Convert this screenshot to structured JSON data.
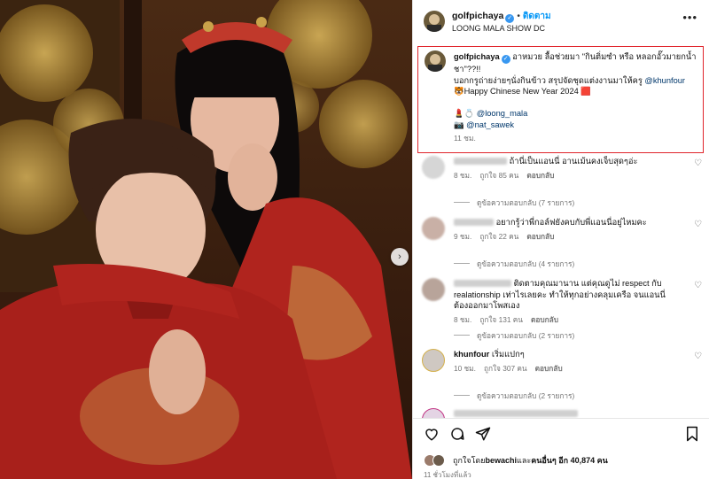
{
  "post": {
    "username": "golfpichaya",
    "follow_label": "ติดตาม",
    "dot": "•",
    "location": "LOONG MALA SHOW DC",
    "more_icon": "more-horizontal-icon"
  },
  "caption": {
    "username": "golfpichaya",
    "line1": "อาหมวย ลื้อช่วยมา \"กินติ่มซำ หรือ หลอกอั๊วมายกน้ำชา\"??!!",
    "line2a": "บอกกรูถ่ายง่ายๆนั่งกินข้าว สรุปจัดชุดแต่งงานมาให้ครู ",
    "mention_khunfour": "@khunfour",
    "line3": "🐯Happy Chinese New Year 2024 🟥",
    "mention_loong": "@loong_mala",
    "mention_nat": "@nat_sawek",
    "emoji_loong": "💄💍",
    "emoji_nat": "📷",
    "time": "11 ชม."
  },
  "comments": [
    {
      "text": "ถ้านี่เป็นแอนนี่ อานเม้นคงเจ็บสุดๆอ่ะ",
      "time": "8 ชม.",
      "likes": "ถูกใจ 85 คน",
      "reply": "ตอบกลับ",
      "view_replies": "ดูข้อความตอบกลับ (7 รายการ)"
    },
    {
      "text": "อยากรู้ว่าพี่กอล์ฟยังคบกับพี่แอนนี่อยู่ไหมคะ",
      "time": "9 ชม.",
      "likes": "ถูกใจ 22 คน",
      "reply": "ตอบกลับ",
      "view_replies": "ดูข้อความตอบกลับ (4 รายการ)"
    },
    {
      "text": "ติดตามคุณมานาน แต่คุณดูไม่ respect กับ realationship เท่าไรเลยคะ ทำให้ทุกอย่างคลุมเครือ จนแอนนี่ต้องออกมาโพสเอง",
      "time": "8 ชม.",
      "likes": "ถูกใจ 131 คน",
      "reply": "ตอบกลับ",
      "view_replies": "ดูข้อความตอบกลับ (2 รายการ)"
    },
    {
      "username": "khunfour",
      "text": "เริ่มแปกๆ",
      "time": "10 ชม.",
      "likes": "ถูกใจ 307 คน",
      "reply": "ตอบกลับ",
      "view_replies": "ดูข้อความตอบกลับ (2 รายการ)"
    }
  ],
  "footer": {
    "liked_by_prefix": "ถูกใจโดย ",
    "liked_by_user": "bewachi",
    "liked_by_mid": " และ",
    "liked_by_others": "คนอื่นๆ อีก 40,874 คน",
    "posted": "11 ชั่วโมงที่แล้ว"
  },
  "colors": {
    "accent": "#0095f6",
    "highlight_box": "#e0242b",
    "verified": "#3897f0",
    "link": "#00376b"
  }
}
